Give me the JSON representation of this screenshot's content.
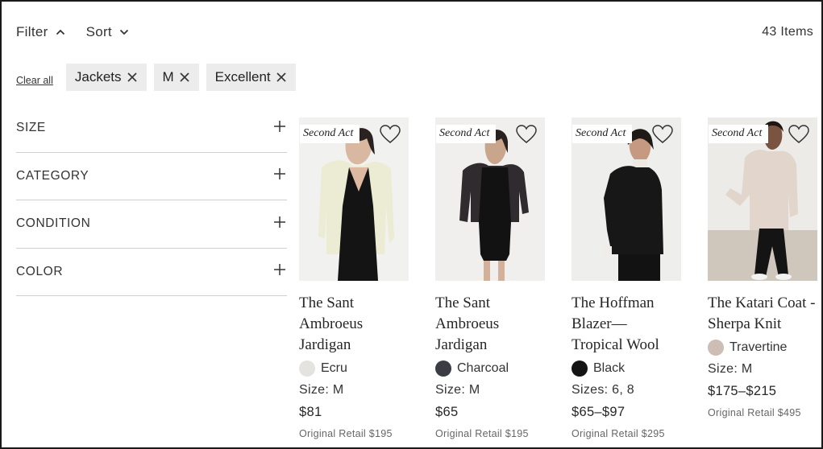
{
  "toolbar": {
    "filter_label": "Filter",
    "sort_label": "Sort",
    "item_count": "43 Items"
  },
  "active_filters": {
    "clear_all_label": "Clear all",
    "chips": [
      "Jackets",
      "M",
      "Excellent"
    ]
  },
  "sidebar": {
    "facets": [
      "SIZE",
      "CATEGORY",
      "CONDITION",
      "COLOR"
    ]
  },
  "products": [
    {
      "badge": "Second Act",
      "name": "The Sant Ambroeus Jardigan",
      "color_name": "Ecru",
      "swatch_color": "#e4e3df",
      "size": "Size: M",
      "price": "$81",
      "original_retail": "Original Retail $195"
    },
    {
      "badge": "Second Act",
      "name": "The Sant Ambroeus Jardigan",
      "color_name": "Charcoal",
      "swatch_color": "#3b3d44",
      "size": "Size: M",
      "price": "$65",
      "original_retail": "Original Retail $195"
    },
    {
      "badge": "Second Act",
      "name": "The Hoffman Blazer— Tropical Wool",
      "color_name": "Black",
      "swatch_color": "#141414",
      "size": "Sizes: 6, 8",
      "price": "$65–$97",
      "original_retail": "Original Retail $295"
    },
    {
      "badge": "Second Act",
      "name": "The Katari Coat - Sherpa Knit",
      "color_name": "Travertine",
      "swatch_color": "#cdbdb4",
      "size": "Size: M",
      "price": "$175–$215",
      "original_retail": "Original Retail $495"
    }
  ]
}
